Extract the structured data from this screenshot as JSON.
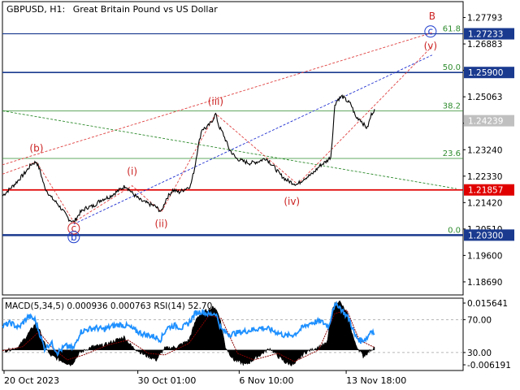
{
  "header": {
    "symbol": "GBPUSD, H1:",
    "description": "Great Britain Pound vs US Dollar"
  },
  "colors": {
    "price_line": "#000000",
    "fib_line": "#2e8b2e",
    "fib_text": "#2e8b2e",
    "level_blue": "#1a3a8f",
    "level_red": "#e00000",
    "wave_red": "#cc2222",
    "wave_blue": "#1a3acc",
    "trend_red_dashed": "#e04040",
    "trend_blue_dashed": "#2030d0",
    "trend_green_dashed": "#2e8b2e",
    "macd_hist": "#000000",
    "macd_signal": "#8b0000",
    "rsi_line": "#1e90ff",
    "current_price_bg": "#c0c0c0"
  },
  "chart_data": [
    {
      "type": "line",
      "title": "GBPUSD, H1",
      "y_ticks": [
        "1.27793",
        "1.26883",
        "1.25973",
        "1.25063",
        "1.24153",
        "1.23240",
        "1.22330",
        "1.21420",
        "1.20510",
        "1.19600",
        "1.18690"
      ],
      "ylim": [
        1.1824,
        1.2834
      ],
      "x_ticks": [
        {
          "label": "20 Oct 2023",
          "index": 2
        },
        {
          "label": "30 Oct 01:00",
          "index": 167
        },
        {
          "label": "6 Nov 10:00",
          "index": 292
        },
        {
          "label": "13 Nov 18:00",
          "index": 424
        }
      ],
      "bar_count": 460,
      "series": [
        {
          "anchors": [
            [
              0,
              1.2165
            ],
            [
              15,
              1.2205
            ],
            [
              28,
              1.2245
            ],
            [
              36,
              1.2275
            ],
            [
              42,
              1.2282
            ],
            [
              46,
              1.2255
            ],
            [
              52,
              1.2195
            ],
            [
              60,
              1.216
            ],
            [
              68,
              1.2138
            ],
            [
              75,
              1.2112
            ],
            [
              82,
              1.2085
            ],
            [
              88,
              1.2075
            ],
            [
              96,
              1.2108
            ],
            [
              104,
              1.2125
            ],
            [
              112,
              1.213
            ],
            [
              122,
              1.2152
            ],
            [
              132,
              1.2162
            ],
            [
              144,
              1.2185
            ],
            [
              152,
              1.22
            ],
            [
              160,
              1.2175
            ],
            [
              170,
              1.215
            ],
            [
              180,
              1.2138
            ],
            [
              188,
              1.213
            ],
            [
              196,
              1.211
            ],
            [
              202,
              1.2155
            ],
            [
              210,
              1.2185
            ],
            [
              218,
              1.2178
            ],
            [
              226,
              1.219
            ],
            [
              232,
              1.22
            ],
            [
              237,
              1.226
            ],
            [
              241,
              1.233
            ],
            [
              246,
              1.2395
            ],
            [
              252,
              1.24
            ],
            [
              258,
              1.242
            ],
            [
              263,
              1.2448
            ],
            [
              267,
              1.2405
            ],
            [
              272,
              1.238
            ],
            [
              280,
              1.2325
            ],
            [
              288,
              1.2295
            ],
            [
              296,
              1.2285
            ],
            [
              305,
              1.2278
            ],
            [
              315,
              1.2283
            ],
            [
              325,
              1.2295
            ],
            [
              335,
              1.2265
            ],
            [
              342,
              1.224
            ],
            [
              350,
              1.222
            ],
            [
              358,
              1.221
            ],
            [
              364,
              1.2205
            ],
            [
              372,
              1.2225
            ],
            [
              382,
              1.224
            ],
            [
              392,
              1.227
            ],
            [
              400,
              1.2285
            ],
            [
              405,
              1.23
            ],
            [
              408,
              1.24
            ],
            [
              410,
              1.248
            ],
            [
              414,
              1.2498
            ],
            [
              419,
              1.2508
            ],
            [
              425,
              1.2492
            ],
            [
              430,
              1.248
            ],
            [
              436,
              1.2435
            ],
            [
              441,
              1.243
            ],
            [
              446,
              1.241
            ],
            [
              450,
              1.2398
            ],
            [
              455,
              1.2445
            ],
            [
              459,
              1.2464
            ]
          ]
        }
      ],
      "levels": [
        {
          "label": "1.27233",
          "value": 1.27233,
          "style": "blue-thin",
          "price_box": "blue"
        },
        {
          "label": "1.25900",
          "value": 1.259,
          "style": "blue",
          "price_box": "blue"
        },
        {
          "label": "1.24239",
          "value": 1.24239,
          "style": "none",
          "price_box": "gray"
        },
        {
          "label": "1.21857",
          "value": 1.21857,
          "style": "red",
          "price_box": "red"
        },
        {
          "label": "1.20300",
          "value": 1.203,
          "style": "blue-thick",
          "price_box": "blue"
        }
      ],
      "fib_levels": [
        {
          "label": "61.8",
          "value": 1.27233
        },
        {
          "label": "50.0",
          "value": 1.259
        },
        {
          "label": "38.2",
          "value": 1.2458
        },
        {
          "label": "23.6",
          "value": 1.2294
        },
        {
          "label": "0.0",
          "value": 1.203
        }
      ],
      "wave_labels": [
        {
          "text": "B",
          "index": 530,
          "value": 1.2773,
          "color": "red"
        },
        {
          "text": "c",
          "index": 528,
          "value": 1.272,
          "color": "blue",
          "circled": true
        },
        {
          "text": "(v)",
          "index": 528,
          "value": 1.267,
          "color": "red"
        },
        {
          "text": "(b)",
          "index": 42,
          "value": 1.2318,
          "color": "red"
        },
        {
          "text": "(iii)",
          "index": 263,
          "value": 1.2479,
          "color": "red"
        },
        {
          "text": "(i)",
          "index": 160,
          "value": 1.2238,
          "color": "red"
        },
        {
          "text": "(ii)",
          "index": 196,
          "value": 1.2057,
          "color": "red"
        },
        {
          "text": "(iv)",
          "index": 357,
          "value": 1.2135,
          "color": "red"
        },
        {
          "text": "c",
          "index": 88,
          "value": 1.2042,
          "color": "red",
          "circled": true
        },
        {
          "text": "b",
          "index": 88,
          "value": 1.2012,
          "color": "blue",
          "circled": true
        }
      ],
      "wave_lines_red": [
        [
          0,
          1.224
        ],
        [
          42,
          1.2282
        ],
        [
          88,
          1.2075
        ],
        [
          160,
          1.22
        ],
        [
          196,
          1.211
        ],
        [
          263,
          1.2448
        ],
        [
          364,
          1.2205
        ],
        [
          530,
          1.268
        ]
      ],
      "trend_lines": [
        {
          "color": "red",
          "from": [
            0,
            1.2272
          ],
          "to": [
            530,
            1.2727
          ]
        },
        {
          "color": "blue",
          "from": [
            88,
            1.2068
          ],
          "to": [
            530,
            1.265
          ]
        },
        {
          "color": "green",
          "from": [
            0,
            1.2458
          ],
          "to": [
            560,
            1.219
          ]
        }
      ]
    },
    {
      "type": "line",
      "title": "MACD(5,34,5) 0.000936 0.000763 RSI(14) 52.70",
      "y_ticks": [
        "0.015641",
        "70.00",
        "30.00",
        "-0.006191"
      ],
      "hist_range": [
        -0.006191,
        0.015641
      ],
      "rsi_range": [
        0,
        100
      ],
      "series": [
        {
          "name": "MACD",
          "anchors": [
            [
              0,
              -0.0005
            ],
            [
              20,
              0.001
            ],
            [
              35,
              0.006
            ],
            [
              42,
              0.0085
            ],
            [
              50,
              0.003
            ],
            [
              58,
              -0.0015
            ],
            [
              70,
              -0.003
            ],
            [
              85,
              -0.0045
            ],
            [
              95,
              -0.001
            ],
            [
              110,
              0.001
            ],
            [
              125,
              0.0015
            ],
            [
              140,
              0.003
            ],
            [
              150,
              0.004
            ],
            [
              160,
              0.001
            ],
            [
              175,
              -0.0015
            ],
            [
              190,
              -0.003
            ],
            [
              200,
              0.0005
            ],
            [
              215,
              0.001
            ],
            [
              230,
              0.003
            ],
            [
              240,
              0.01
            ],
            [
              252,
              0.012
            ],
            [
              262,
              0.013
            ],
            [
              268,
              0.01
            ],
            [
              275,
              0.001
            ],
            [
              285,
              -0.003
            ],
            [
              300,
              -0.0045
            ],
            [
              315,
              -0.002
            ],
            [
              330,
              0.0005
            ],
            [
              340,
              -0.002
            ],
            [
              350,
              -0.004
            ],
            [
              360,
              -0.0045
            ],
            [
              372,
              -0.001
            ],
            [
              385,
              0.0005
            ],
            [
              400,
              0.002
            ],
            [
              408,
              0.0135
            ],
            [
              415,
              0.015
            ],
            [
              425,
              0.011
            ],
            [
              435,
              0.002
            ],
            [
              445,
              -0.002
            ],
            [
              452,
              -0.0005
            ],
            [
              459,
              0.0009
            ]
          ]
        },
        {
          "name": "Signal",
          "anchors": [
            [
              0,
              -0.0002
            ],
            [
              25,
              0.001
            ],
            [
              45,
              0.0055
            ],
            [
              60,
              0.001
            ],
            [
              80,
              -0.003
            ],
            [
              100,
              -0.0015
            ],
            [
              130,
              0.0015
            ],
            [
              155,
              0.003
            ],
            [
              180,
              -0.001
            ],
            [
              200,
              -0.0015
            ],
            [
              230,
              0.002
            ],
            [
              255,
              0.0105
            ],
            [
              270,
              0.0095
            ],
            [
              290,
              -0.001
            ],
            [
              310,
              -0.003
            ],
            [
              340,
              -0.001
            ],
            [
              360,
              -0.0035
            ],
            [
              390,
              0.0
            ],
            [
              410,
              0.011
            ],
            [
              425,
              0.012
            ],
            [
              440,
              0.003
            ],
            [
              459,
              0.00076
            ]
          ]
        },
        {
          "name": "RSI",
          "anchors": [
            [
              0,
              62
            ],
            [
              10,
              66
            ],
            [
              20,
              60
            ],
            [
              32,
              74
            ],
            [
              40,
              70
            ],
            [
              47,
              50
            ],
            [
              52,
              35
            ],
            [
              60,
              42
            ],
            [
              68,
              30
            ],
            [
              78,
              38
            ],
            [
              88,
              35
            ],
            [
              96,
              55
            ],
            [
              105,
              58
            ],
            [
              115,
              60
            ],
            [
              125,
              58
            ],
            [
              135,
              62
            ],
            [
              145,
              64
            ],
            [
              155,
              62
            ],
            [
              165,
              56
            ],
            [
              175,
              52
            ],
            [
              185,
              50
            ],
            [
              195,
              46
            ],
            [
              203,
              60
            ],
            [
              212,
              63
            ],
            [
              222,
              60
            ],
            [
              230,
              66
            ],
            [
              238,
              78
            ],
            [
              246,
              80
            ],
            [
              255,
              76
            ],
            [
              263,
              78
            ],
            [
              270,
              58
            ],
            [
              280,
              52
            ],
            [
              290,
              54
            ],
            [
              300,
              56
            ],
            [
              310,
              58
            ],
            [
              320,
              60
            ],
            [
              330,
              58
            ],
            [
              340,
              54
            ],
            [
              350,
              50
            ],
            [
              360,
              52
            ],
            [
              370,
              60
            ],
            [
              380,
              66
            ],
            [
              392,
              68
            ],
            [
              403,
              62
            ],
            [
              408,
              85
            ],
            [
              414,
              88
            ],
            [
              420,
              80
            ],
            [
              428,
              70
            ],
            [
              435,
              50
            ],
            [
              442,
              44
            ],
            [
              450,
              48
            ],
            [
              455,
              58
            ],
            [
              459,
              52.7
            ]
          ]
        }
      ],
      "levels": [
        70,
        30
      ]
    }
  ]
}
